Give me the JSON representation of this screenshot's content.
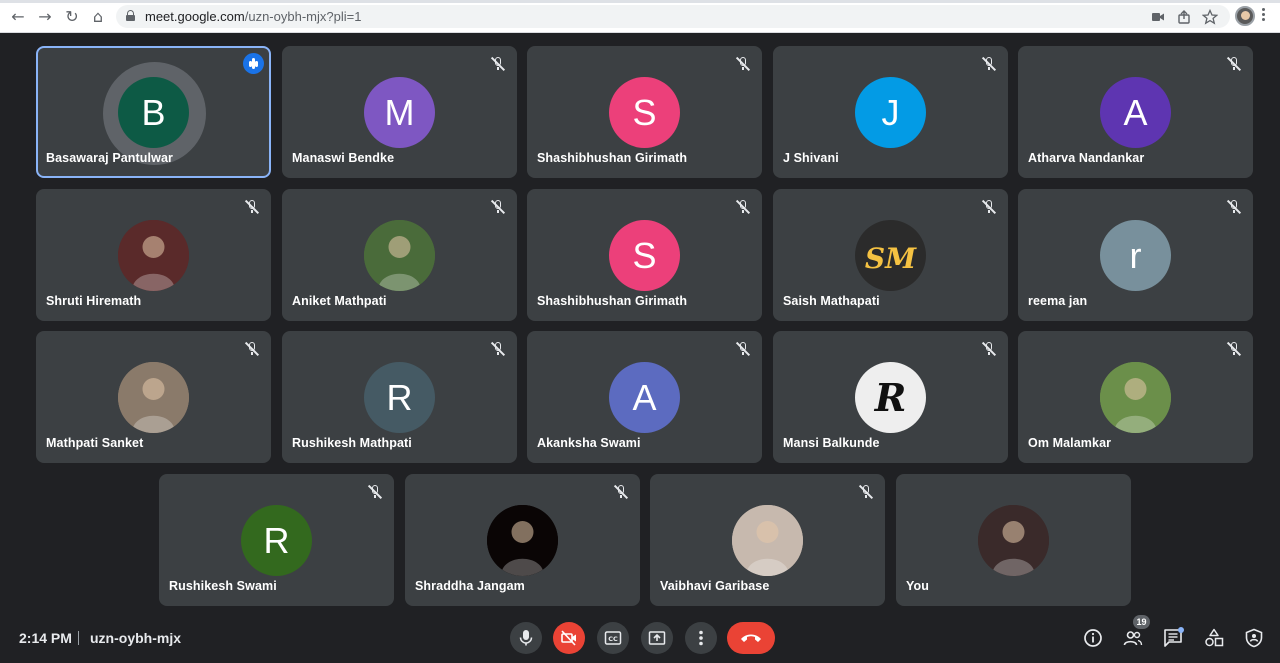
{
  "browser": {
    "url_host": "meet.google.com",
    "url_rest": "/uzn-oybh-mjx?pli=1",
    "back_glyph": "←",
    "forward_glyph": "→",
    "reload_glyph": "↻",
    "home_glyph": "⌂"
  },
  "participants": [
    {
      "name": "Basawaraj Pantulwar",
      "initial": "B",
      "color": "#0d5a45",
      "active": true
    },
    {
      "name": "Manaswi Bendke",
      "initial": "M",
      "color": "#7e57c2"
    },
    {
      "name": "Shashibhushan Girimath",
      "initial": "S",
      "color": "#ec407a"
    },
    {
      "name": "J Shivani",
      "initial": "J",
      "color": "#039be5"
    },
    {
      "name": "Atharva Nandankar",
      "initial": "A",
      "color": "#5e35b1"
    },
    {
      "name": "Shruti Hiremath",
      "initial": "",
      "color": "#5a2a2a",
      "photo": true
    },
    {
      "name": "Aniket Mathpati",
      "initial": "",
      "color": "#4a6b3a",
      "photo": true
    },
    {
      "name": "Shashibhushan Girimath",
      "initial": "S",
      "color": "#ec407a"
    },
    {
      "name": "Saish Mathapati",
      "initial": "",
      "color": "#2b2b2b",
      "photo": true,
      "logo_text": "SM"
    },
    {
      "name": "reema jan",
      "initial": "r",
      "color": "#78909c"
    },
    {
      "name": "Mathpati Sanket",
      "initial": "",
      "color": "#8a7a6a",
      "photo": true
    },
    {
      "name": "Rushikesh Mathpati",
      "initial": "R",
      "color": "#455a64"
    },
    {
      "name": "Akanksha Swami",
      "initial": "A",
      "color": "#5c6bc0"
    },
    {
      "name": "Mansi Balkunde",
      "initial": "",
      "color": "#eeeeee",
      "photo": true,
      "logo_text": "R"
    },
    {
      "name": "Om Malamkar",
      "initial": "",
      "color": "#6b8f4a",
      "photo": true
    },
    {
      "name": "Rushikesh Swami",
      "initial": "R",
      "color": "#33691e"
    },
    {
      "name": "Shraddha Jangam",
      "initial": "",
      "color": "#0a0505",
      "photo": true
    },
    {
      "name": "Vaibhavi Garibase",
      "initial": "",
      "color": "#c7b9ae",
      "photo": true
    },
    {
      "name": "You",
      "initial": "",
      "color": "#3a2a2a",
      "photo": true,
      "self": true
    }
  ],
  "bottom": {
    "time": "2:14 PM",
    "meeting_code": "uzn-oybh-mjx",
    "people_count": "19"
  },
  "icons": {
    "mic": "mic-icon",
    "camera_off": "camera-off-icon",
    "captions": "captions-icon",
    "present": "present-screen-icon",
    "more": "more-options-icon",
    "end_call": "end-call-icon",
    "info": "info-icon",
    "people": "people-icon",
    "chat": "chat-icon",
    "activities": "activities-icon",
    "host_controls": "host-controls-icon"
  }
}
